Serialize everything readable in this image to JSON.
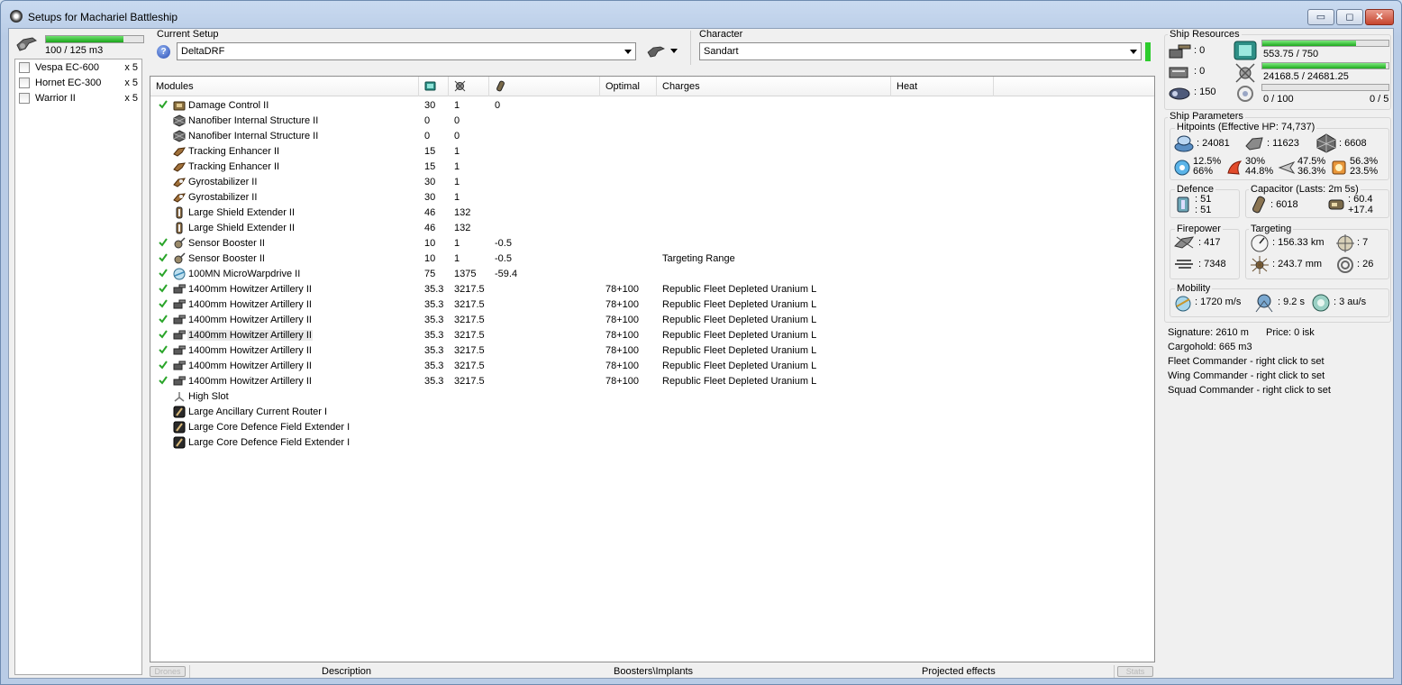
{
  "window": {
    "title": "Setups for Machariel Battleship",
    "min": "▭",
    "max": "◻",
    "close": "✕"
  },
  "drones": {
    "bay_text": "100 / 125 m3",
    "bay_fraction": 0.8,
    "items": [
      {
        "name": "Vespa EC-600",
        "qty": "x 5"
      },
      {
        "name": "Hornet EC-300",
        "qty": "x 5"
      },
      {
        "name": "Warrior II",
        "qty": "x 5"
      }
    ]
  },
  "setup": {
    "label": "Current Setup",
    "value": "DeltaDRF",
    "help": "?"
  },
  "character": {
    "label": "Character",
    "value": "Sandart"
  },
  "columns": {
    "modules": "Modules",
    "optimal": "Optimal",
    "charges": "Charges",
    "heat": "Heat"
  },
  "modules": [
    {
      "checked": true,
      "icon": "damage-control-icon",
      "name": "Damage Control II",
      "cpu": "30",
      "pg": "1",
      "cap": "0",
      "optimal": "",
      "charge": ""
    },
    {
      "checked": false,
      "icon": "nanofiber-icon",
      "name": "Nanofiber Internal Structure II",
      "cpu": "0",
      "pg": "0",
      "cap": "",
      "optimal": "",
      "charge": ""
    },
    {
      "checked": false,
      "icon": "nanofiber-icon",
      "name": "Nanofiber Internal Structure II",
      "cpu": "0",
      "pg": "0",
      "cap": "",
      "optimal": "",
      "charge": ""
    },
    {
      "checked": false,
      "icon": "tracking-enhancer-icon",
      "name": "Tracking Enhancer II",
      "cpu": "15",
      "pg": "1",
      "cap": "",
      "optimal": "",
      "charge": ""
    },
    {
      "checked": false,
      "icon": "tracking-enhancer-icon",
      "name": "Tracking Enhancer II",
      "cpu": "15",
      "pg": "1",
      "cap": "",
      "optimal": "",
      "charge": ""
    },
    {
      "checked": false,
      "icon": "gyrostabilizer-icon",
      "name": "Gyrostabilizer II",
      "cpu": "30",
      "pg": "1",
      "cap": "",
      "optimal": "",
      "charge": ""
    },
    {
      "checked": false,
      "icon": "gyrostabilizer-icon",
      "name": "Gyrostabilizer II",
      "cpu": "30",
      "pg": "1",
      "cap": "",
      "optimal": "",
      "charge": ""
    },
    {
      "checked": false,
      "icon": "shield-extender-icon",
      "name": "Large Shield Extender II",
      "cpu": "46",
      "pg": "132",
      "cap": "",
      "optimal": "",
      "charge": ""
    },
    {
      "checked": false,
      "icon": "shield-extender-icon",
      "name": "Large Shield Extender II",
      "cpu": "46",
      "pg": "132",
      "cap": "",
      "optimal": "",
      "charge": ""
    },
    {
      "checked": true,
      "icon": "sensor-booster-icon",
      "name": "Sensor Booster II",
      "cpu": "10",
      "pg": "1",
      "cap": "-0.5",
      "optimal": "",
      "charge": ""
    },
    {
      "checked": true,
      "icon": "sensor-booster-icon",
      "name": "Sensor Booster II",
      "cpu": "10",
      "pg": "1",
      "cap": "-0.5",
      "optimal": "",
      "charge": "Targeting Range"
    },
    {
      "checked": true,
      "icon": "microwarpdrive-icon",
      "name": "100MN MicroWarpdrive II",
      "cpu": "75",
      "pg": "1375",
      "cap": "-59.4",
      "optimal": "",
      "charge": ""
    },
    {
      "checked": true,
      "icon": "artillery-icon",
      "name": "1400mm Howitzer Artillery II",
      "cpu": "35.3",
      "pg": "3217.5",
      "cap": "",
      "optimal": "78+100",
      "charge": "Republic Fleet Depleted Uranium L"
    },
    {
      "checked": true,
      "icon": "artillery-icon",
      "name": "1400mm Howitzer Artillery II",
      "cpu": "35.3",
      "pg": "3217.5",
      "cap": "",
      "optimal": "78+100",
      "charge": "Republic Fleet Depleted Uranium L"
    },
    {
      "checked": true,
      "icon": "artillery-icon",
      "name": "1400mm Howitzer Artillery II",
      "cpu": "35.3",
      "pg": "3217.5",
      "cap": "",
      "optimal": "78+100",
      "charge": "Republic Fleet Depleted Uranium L"
    },
    {
      "checked": true,
      "icon": "artillery-icon",
      "name": "1400mm Howitzer Artillery II",
      "cpu": "35.3",
      "pg": "3217.5",
      "cap": "",
      "optimal": "78+100",
      "charge": "Republic Fleet Depleted Uranium L",
      "highlight": true
    },
    {
      "checked": true,
      "icon": "artillery-icon",
      "name": "1400mm Howitzer Artillery II",
      "cpu": "35.3",
      "pg": "3217.5",
      "cap": "",
      "optimal": "78+100",
      "charge": "Republic Fleet Depleted Uranium L"
    },
    {
      "checked": true,
      "icon": "artillery-icon",
      "name": "1400mm Howitzer Artillery II",
      "cpu": "35.3",
      "pg": "3217.5",
      "cap": "",
      "optimal": "78+100",
      "charge": "Republic Fleet Depleted Uranium L"
    },
    {
      "checked": true,
      "icon": "artillery-icon",
      "name": "1400mm Howitzer Artillery II",
      "cpu": "35.3",
      "pg": "3217.5",
      "cap": "",
      "optimal": "78+100",
      "charge": "Republic Fleet Depleted Uranium L"
    },
    {
      "checked": false,
      "icon": "high-slot-icon",
      "name": "High Slot",
      "cpu": "",
      "pg": "",
      "cap": "",
      "optimal": "",
      "charge": ""
    },
    {
      "checked": false,
      "icon": "rig-icon",
      "name": "Large Ancillary Current Router I",
      "cpu": "",
      "pg": "",
      "cap": "",
      "optimal": "",
      "charge": ""
    },
    {
      "checked": false,
      "icon": "rig-icon",
      "name": "Large Core Defence Field Extender I",
      "cpu": "",
      "pg": "",
      "cap": "",
      "optimal": "",
      "charge": ""
    },
    {
      "checked": false,
      "icon": "rig-icon",
      "name": "Large Core Defence Field Extender I",
      "cpu": "",
      "pg": "",
      "cap": "",
      "optimal": "",
      "charge": ""
    }
  ],
  "bottom": {
    "drones": "Drones",
    "description": "Description",
    "boosters": "Boosters\\Implants",
    "projected": "Projected effects",
    "stats": "Stats"
  },
  "resources": {
    "label": "Ship Resources",
    "turrets": ": 0",
    "launchers": ": 0",
    "calibration": ": 150",
    "cpu_text": "553.75 / 750",
    "cpu_fraction": 0.74,
    "pg_text": "24168.5 / 24681.25",
    "pg_fraction": 0.98,
    "bandwidth_text": "0 / 100",
    "bandwidth_fraction": 0,
    "drones_text": "0 / 5"
  },
  "params": {
    "label": "Ship Parameters",
    "hitpoints_label": "Hitpoints (Effective HP: 74,737)",
    "shield_hp": ": 24081",
    "armor_hp": ": 11623",
    "structure_hp": ": 6608",
    "em": [
      "12.5%",
      "66%"
    ],
    "thermal": [
      "30%",
      "44.8%"
    ],
    "kinetic": [
      "47.5%",
      "36.3%"
    ],
    "explosive": [
      "56.3%",
      "23.5%"
    ],
    "defence_label": "Defence",
    "def_a": ": 51",
    "def_b": ": 51",
    "capacitor_label": "Capacitor (Lasts: 2m 5s)",
    "cap_amount": ": 6018",
    "cap_a": ": 60.4",
    "cap_b": "+17.4",
    "firepower_label": "Firepower",
    "dps": ": 417",
    "volley": ": 7348",
    "targeting_label": "Targeting",
    "range": ": 156.33 km",
    "max_targets": ": 7",
    "scan_res": ": 243.7 mm",
    "sensor": ": 26",
    "mobility_label": "Mobility",
    "speed": ": 1720 m/s",
    "align": ": 9.2 s",
    "warp": ": 3 au/s",
    "signature": "Signature: 2610 m",
    "price": "Price: 0 isk",
    "cargohold": "Cargohold: 665 m3",
    "fleet_cmd": "Fleet Commander - right click to set",
    "wing_cmd": "Wing Commander - right click to set",
    "squad_cmd": "Squad Commander - right click to set"
  }
}
